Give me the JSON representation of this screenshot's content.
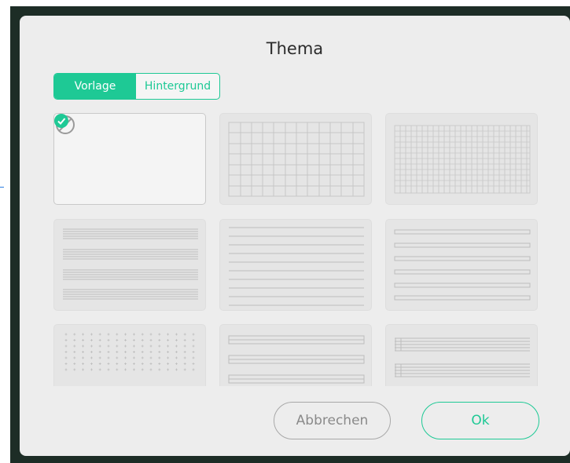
{
  "dialog": {
    "title": "Thema",
    "tabs": [
      {
        "label": "Vorlage",
        "active": true
      },
      {
        "label": "Hintergrund",
        "active": false
      }
    ],
    "templates": [
      {
        "name": "none",
        "icon": "no-symbol-icon",
        "selected": true
      },
      {
        "name": "grid-large",
        "selected": false
      },
      {
        "name": "grid-small",
        "selected": false
      },
      {
        "name": "music-staff",
        "selected": false
      },
      {
        "name": "lined",
        "selected": false
      },
      {
        "name": "lined-wide",
        "selected": false
      },
      {
        "name": "dot-grid",
        "selected": false
      },
      {
        "name": "double-lines",
        "selected": false
      },
      {
        "name": "tab-staff",
        "selected": false
      }
    ],
    "buttons": {
      "cancel": "Abbrechen",
      "ok": "Ok"
    }
  },
  "colors": {
    "accent": "#1ec995",
    "dialog_bg": "#ededed",
    "backdrop": "#1d2d26"
  }
}
